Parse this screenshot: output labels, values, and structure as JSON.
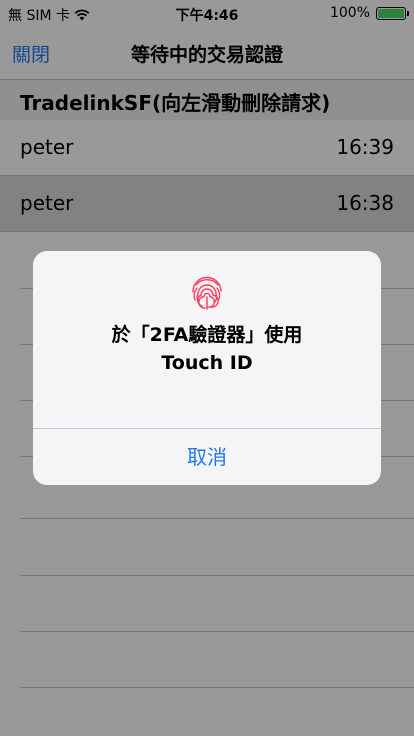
{
  "status_bar": {
    "carrier": "無 SIM 卡",
    "time": "下午4:46",
    "battery_percent": "100%",
    "battery_level": 1.0,
    "battery_color": "#4cd964"
  },
  "nav": {
    "back_label": "關閉",
    "title": "等待中的交易認證"
  },
  "section": {
    "header": "TradelinkSF(向左滑動刪除請求)"
  },
  "requests": [
    {
      "name": "peter",
      "time": "16:39"
    },
    {
      "name": "peter",
      "time": "16:38"
    }
  ],
  "alert": {
    "message_line1": "於「2FA驗證器」使用",
    "message_line2": "Touch ID",
    "cancel_label": "取消",
    "icon": "fingerprint-icon"
  },
  "colors": {
    "accent": "#1e78f5",
    "fingerprint": "#ff3b5c"
  }
}
